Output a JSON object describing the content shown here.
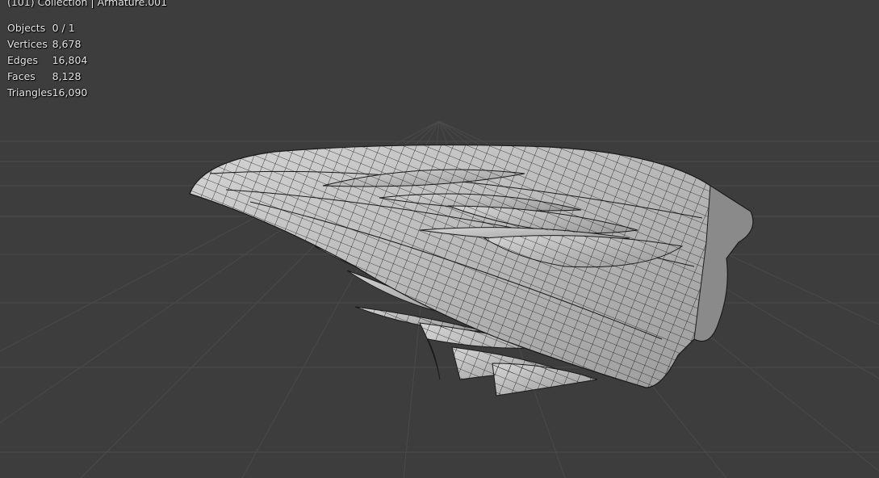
{
  "viewport": {
    "header": "(101) Collection | Armature.001",
    "stats": [
      {
        "label": "Objects",
        "value": "0 / 1"
      },
      {
        "label": "Vertices",
        "value": "8,678"
      },
      {
        "label": "Edges",
        "value": "16,804"
      },
      {
        "label": "Faces",
        "value": "8,128"
      },
      {
        "label": "Triangles",
        "value": "16,090"
      }
    ]
  },
  "colors": {
    "background": "#3d3d3d",
    "grid": "#4a4a4a",
    "mesh_fill": "#b9b9b9",
    "mesh_wire": "#1a1a1a",
    "text": "#e6e6e6"
  }
}
